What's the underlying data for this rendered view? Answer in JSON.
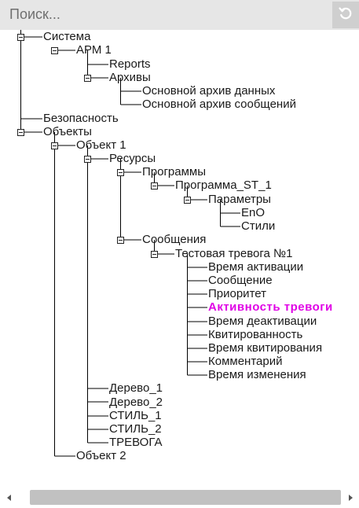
{
  "search": {
    "placeholder": "Поиск..."
  },
  "reset_icon": "refresh-icon",
  "colors": {
    "selected": "#e000e6",
    "search_bg": "#e6e6e6"
  },
  "tree": {
    "sistema": "Система",
    "arm1": "АРМ 1",
    "reports": "Reports",
    "arkhivy": "Архивы",
    "archive_data": "Основной архив данных",
    "archive_msgs": "Основной архив сообщений",
    "bezopasnost": "Безопасность",
    "obekty": "Объекты",
    "obekt1": "Объект 1",
    "resursy": "Ресурсы",
    "programmy": "Программы",
    "programma_st1": "Программа_ST_1",
    "parametry": "Параметры",
    "eno": "EnO",
    "stili": "Стили",
    "soobshcheniya": "Сообщения",
    "test_alarm": "Тестовая тревога №1",
    "alarm_fields": [
      "Время активации",
      "Сообщение",
      "Приоритет",
      "Активность тревоги",
      "Время деактивации",
      "Квитированность",
      "Время квитирования",
      "Комментарий",
      "Время изменения"
    ],
    "derevo1": "Дерево_1",
    "derevo2": "Дерево_2",
    "stil1": "СТИЛЬ_1",
    "stil2": "СТИЛЬ_2",
    "trevoga": "ТРЕВОГА",
    "obekt2": "Объект 2"
  }
}
